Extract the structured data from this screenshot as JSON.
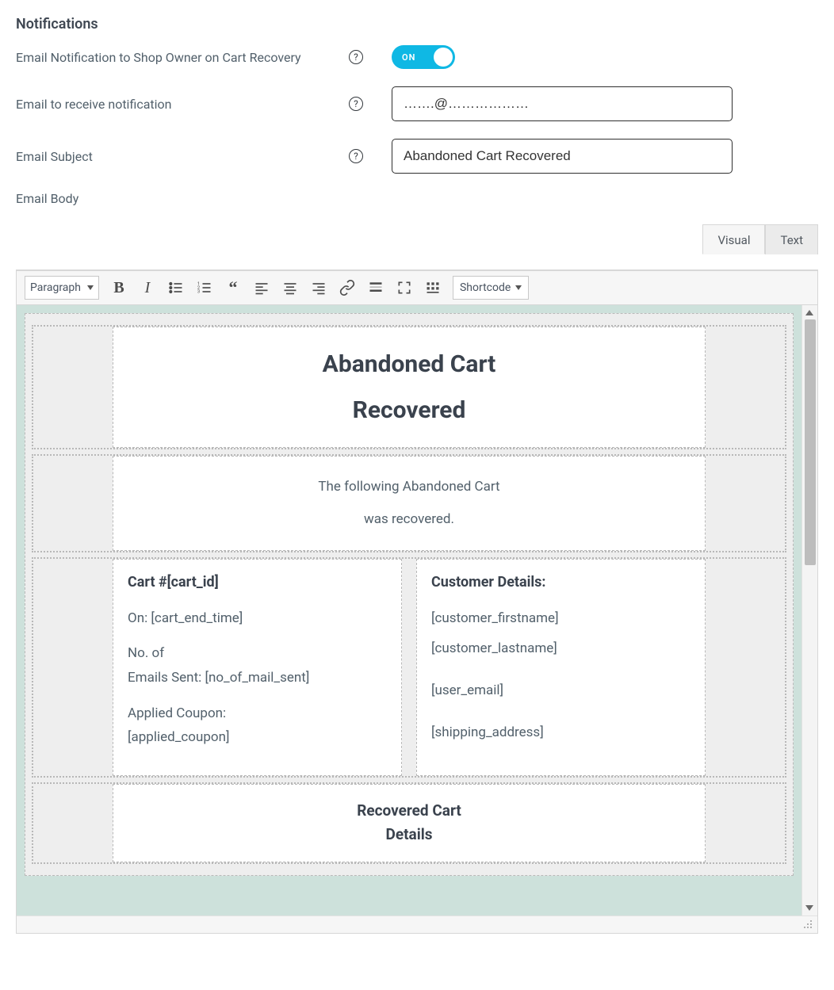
{
  "section_title": "Notifications",
  "rows": {
    "toggle": {
      "label": "Email Notification to Shop Owner on Cart Recovery",
      "state_text": "ON"
    },
    "email_to": {
      "label": "Email to receive notification",
      "value": "…….@………………"
    },
    "email_subject": {
      "label": "Email Subject",
      "value": "Abandoned Cart Recovered"
    },
    "email_body_label": "Email Body"
  },
  "editor": {
    "tabs": {
      "visual": "Visual",
      "text": "Text",
      "active": "Visual"
    },
    "format_select": "Paragraph",
    "shortcode_select": "Shortcode"
  },
  "template": {
    "header_title_line1": "Abandoned Cart",
    "header_title_line2": "Recovered",
    "intro_line1": "The following Abandoned Cart",
    "intro_line2": "was recovered.",
    "left": {
      "title": "Cart #[cart_id]",
      "on": "On: [cart_end_time]",
      "noof_line1": "No. of",
      "noof_line2": "Emails Sent: [no_of_mail_sent]",
      "coupon_line1": "Applied Coupon:",
      "coupon_line2": "[applied_coupon]"
    },
    "right": {
      "title": "Customer Details:",
      "firstname": "[customer_firstname]",
      "lastname": "[customer_lastname]",
      "email": "[user_email]",
      "shipping": "[shipping_address]"
    },
    "recovered_line1": "Recovered Cart",
    "recovered_line2": "Details"
  }
}
